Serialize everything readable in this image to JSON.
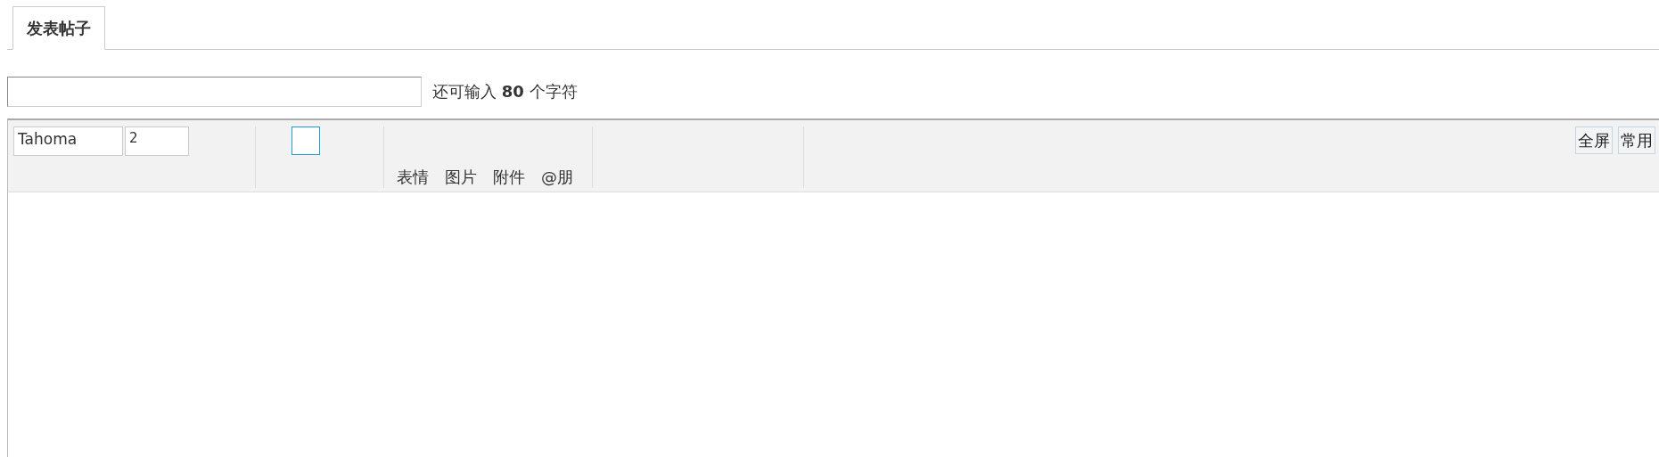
{
  "tabs": [
    {
      "label": "发表帖子",
      "selected": true
    }
  ],
  "title_counter": "还可输入 **80** 个字符",
  "toolbar": {
    "font": "Tahoma",
    "size": "2",
    "insert_items": [
      "表情",
      "图片",
      "附件",
      "@朋"
    ],
    "right_buttons": [
      "全屏",
      "常用"
    ]
  }
}
